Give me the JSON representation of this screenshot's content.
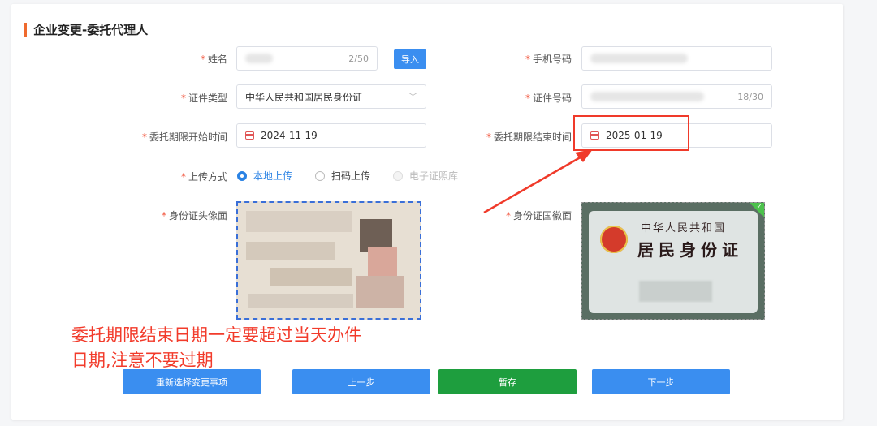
{
  "section_title": "企业变更-委托代理人",
  "form": {
    "name": {
      "label": "姓名",
      "required_mark": "*",
      "count": "2/50",
      "import_label": "导入"
    },
    "phone": {
      "label": "手机号码",
      "required_mark": "*"
    },
    "id_type": {
      "label": "证件类型",
      "required_mark": "*",
      "value": "中华人民共和国居民身份证"
    },
    "id_number": {
      "label": "证件号码",
      "required_mark": "*",
      "count": "18/30"
    },
    "start_date": {
      "label": "委托期限开始时间",
      "required_mark": "*",
      "value": "2024-11-19"
    },
    "end_date": {
      "label": "委托期限结束时间",
      "required_mark": "*",
      "value": "2025-01-19"
    },
    "upload_method": {
      "label": "上传方式",
      "required_mark": "*",
      "options": [
        {
          "label": "本地上传",
          "state": "selected"
        },
        {
          "label": "扫码上传",
          "state": "unselected"
        },
        {
          "label": "电子证照库",
          "state": "disabled"
        }
      ]
    },
    "id_front": {
      "label": "身份证头像面",
      "required_mark": "*"
    },
    "id_back": {
      "label": "身份证国徽面",
      "required_mark": "*",
      "card_line1": "中华人民共和国",
      "card_line2": "居民身份证"
    }
  },
  "annotation": {
    "line1": "委托期限结束日期一定要超过当天办件",
    "line2": "日期,注意不要过期",
    "color": "#f23b2b"
  },
  "buttons": {
    "reselect": "重新选择变更事项",
    "prev": "上一步",
    "save": "暂存",
    "next": "下一步"
  },
  "colors": {
    "primary": "#3a8ef0",
    "save": "#1e9e3e",
    "accent_bar": "#ef6a2e"
  }
}
